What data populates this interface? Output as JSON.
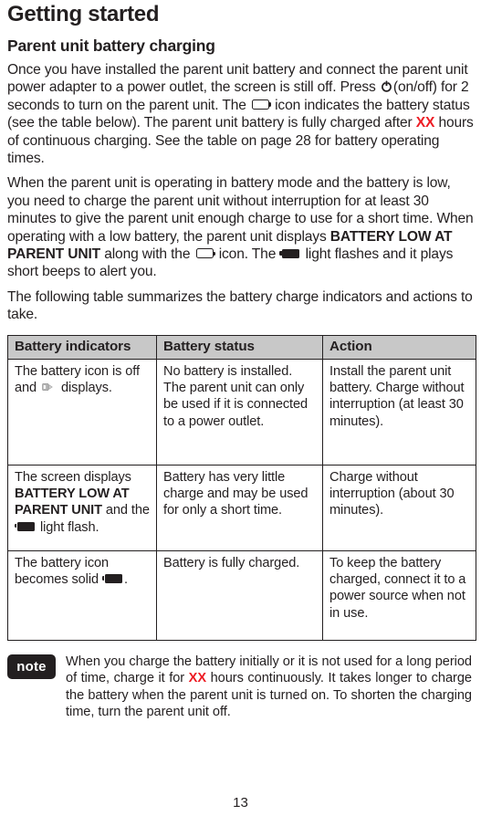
{
  "document": {
    "chapter_title": "Getting started",
    "section_title": "Parent unit battery charging",
    "page_number": "13"
  },
  "paragraphs": {
    "p1": {
      "seg1": "Once you have installed the parent unit battery and connect the parent unit power adapter to a power outlet, the screen is still off. Press ",
      "icon1": "power-on-off-icon",
      "seg2": "(on/off) for 2 seconds to turn on the parent unit. The ",
      "icon2": "battery-empty-icon",
      "seg3": " icon indicates the battery status (see the table below). The parent unit battery is fully charged after ",
      "highlight": "XX",
      "seg4": " hours of continuous charging. See the table on page 28 for battery operating times."
    },
    "p2": {
      "seg1": "When the parent unit is operating in battery mode and the battery is low, you need to charge the parent unit without interruption for at least 30 minutes to give the parent unit enough charge to use for a short time. When operating with a low battery, the parent unit displays ",
      "bold1": "BATTERY LOW AT PARENT UNIT",
      "seg2": " along with the ",
      "icon1": "battery-empty-icon",
      "seg3": " icon. The ",
      "icon2": "battery-full-icon",
      "seg4": " light flashes and it plays short beeps to alert you."
    },
    "p3": {
      "text": "The following table summarizes the battery charge indicators and actions to take."
    }
  },
  "table": {
    "headers": [
      "Battery indicators",
      "Battery status",
      "Action"
    ],
    "rows": [
      {
        "indicator": {
          "seg1": "The battery icon is off and ",
          "icon": "power-adapter-plug-icon",
          "seg2": " displays."
        },
        "status": "No battery is installed. The parent unit can only be used if it is connected to a power outlet.",
        "action": "Install the parent unit battery. Charge without interruption (at least 30 minutes)."
      },
      {
        "indicator": {
          "seg1": "The screen displays ",
          "bold": "BATTERY LOW AT PARENT UNIT",
          "seg2": " and the ",
          "icon": "battery-full-icon",
          "seg3": " light flash."
        },
        "status": "Battery has very little charge and may be used for only a short time.",
        "action": "Charge without interruption (about 30 minutes)."
      },
      {
        "indicator": {
          "seg1": "The battery icon becomes solid ",
          "icon": "battery-full-icon",
          "seg2": "."
        },
        "status": "Battery is fully charged.",
        "action": "To keep the battery charged, connect it to a power source when not in use."
      }
    ]
  },
  "note": {
    "badge_label": "note",
    "seg1": "When you charge the battery initially or it is not used for a long period of time, charge it for ",
    "highlight": "XX",
    "seg2": " hours continuously. It takes longer to charge the battery when the parent unit is turned on. To shorten the charging time, turn the parent unit off."
  },
  "colors": {
    "text": "#231f20",
    "highlight_red": "#ed1c24",
    "table_header_bg": "#c8c8c8",
    "note_badge_bg": "#231f20"
  }
}
